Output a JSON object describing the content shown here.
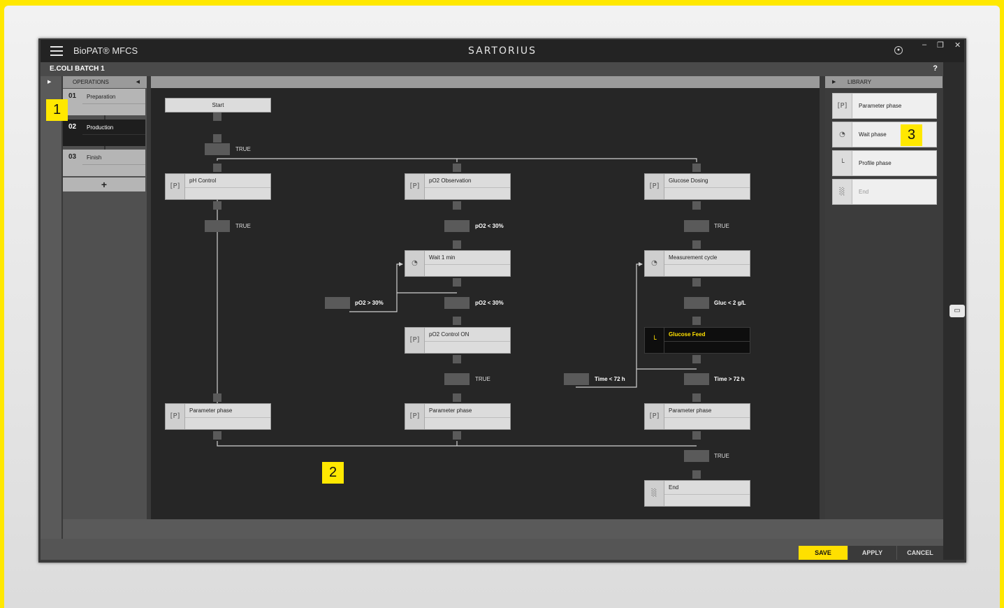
{
  "app": {
    "title": "BioPAT® MFCS",
    "brand": "SARTORIUS",
    "minimize": "–",
    "restore": "❐",
    "close": "✕"
  },
  "process": {
    "name": "E.COLI BATCH 1",
    "help": "?"
  },
  "operations": {
    "header": "OPERATIONS",
    "add_label": "+",
    "items": [
      {
        "num": "01",
        "label": "Preparation",
        "active": false
      },
      {
        "num": "02",
        "label": "Production",
        "active": true
      },
      {
        "num": "03",
        "label": "Finish",
        "active": false
      }
    ]
  },
  "library": {
    "header": "LIBRARY",
    "items": [
      {
        "label": "Parameter phase",
        "icon": "parameter-icon"
      },
      {
        "label": "Wait phase",
        "icon": "clock-icon"
      },
      {
        "label": "Profile phase",
        "icon": "profile-icon"
      },
      {
        "label": "End",
        "icon": "finish-flag-icon"
      }
    ]
  },
  "flow": {
    "start": "Start",
    "transitions": {
      "t_start": "TRUE",
      "t_ph": "TRUE",
      "t_po2_low1": "pO2 < 30%",
      "t_po2_low2": "pO2 < 30%",
      "t_po2_high": "pO2 > 30%",
      "t_po2_true": "TRUE",
      "t_gluc_true": "TRUE",
      "t_gluc_low": "Gluc < 2 g/L",
      "t_time_lt": "Time < 72 h",
      "t_time_gt": "Time > 72 h",
      "t_end_true": "TRUE"
    },
    "nodes": {
      "ph_control": "pH Control",
      "po2_observation": "pO2 Observation",
      "glucose_dosing": "Glucose Dosing",
      "wait_1min": "Wait 1 min",
      "measurement_cycle": "Measurement cycle",
      "po2_control_on": "pO2 Control ON",
      "glucose_feed": "Glucose Feed",
      "param_left": "Parameter phase",
      "param_mid": "Parameter phase",
      "param_right": "Parameter phase",
      "end": "End"
    },
    "icons": {
      "parameter": "[P]",
      "wait": "◔",
      "profile": "└",
      "end": "░"
    }
  },
  "footer": {
    "save": "SAVE",
    "apply": "APPLY",
    "cancel": "CANCEL"
  },
  "callouts": {
    "c1": "1",
    "c2": "2",
    "c3": "3"
  },
  "colors": {
    "accent": "#ffe000",
    "background": "#262626",
    "node": "#dcdcdc"
  }
}
